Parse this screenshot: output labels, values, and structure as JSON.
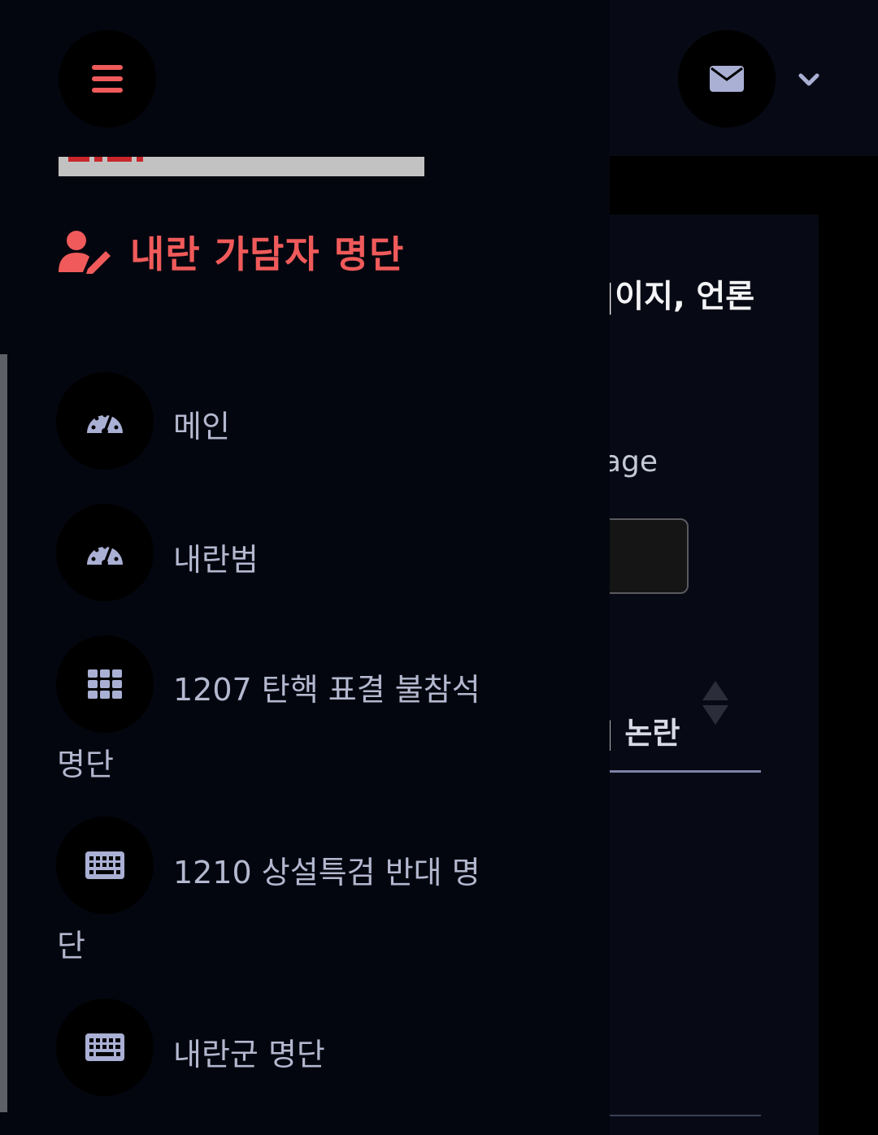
{
  "header": {
    "menu_icon": "bars-icon",
    "mail_icon": "envelope-icon",
    "dropdown_icon": "chevron-down-icon"
  },
  "brand": {
    "icon": "user-edit-icon",
    "title": "내란 가담자 명단",
    "color": "#f05a5a"
  },
  "nav": {
    "items": [
      {
        "icon": "tachometer-icon",
        "label": "메인"
      },
      {
        "icon": "tachometer-icon",
        "label": "내란범"
      },
      {
        "icon": "th-icon",
        "label_line1": "1207 탄핵 표결 불참석",
        "label_line2": "명단"
      },
      {
        "icon": "keyboard-icon",
        "label_line1": "1210 상설특검 반대 명",
        "label_line2": "단"
      },
      {
        "icon": "keyboard-icon",
        "label": "내란군 명단"
      }
    ]
  },
  "background_page": {
    "heading_fragment": "|이지, 언론",
    "label_fragment": "age",
    "column_fragment": "| 논란"
  },
  "colors": {
    "accent": "#f05a5a",
    "nav_text": "#b4b8cf",
    "icon": "#aab0d4",
    "background": "#04060f"
  }
}
